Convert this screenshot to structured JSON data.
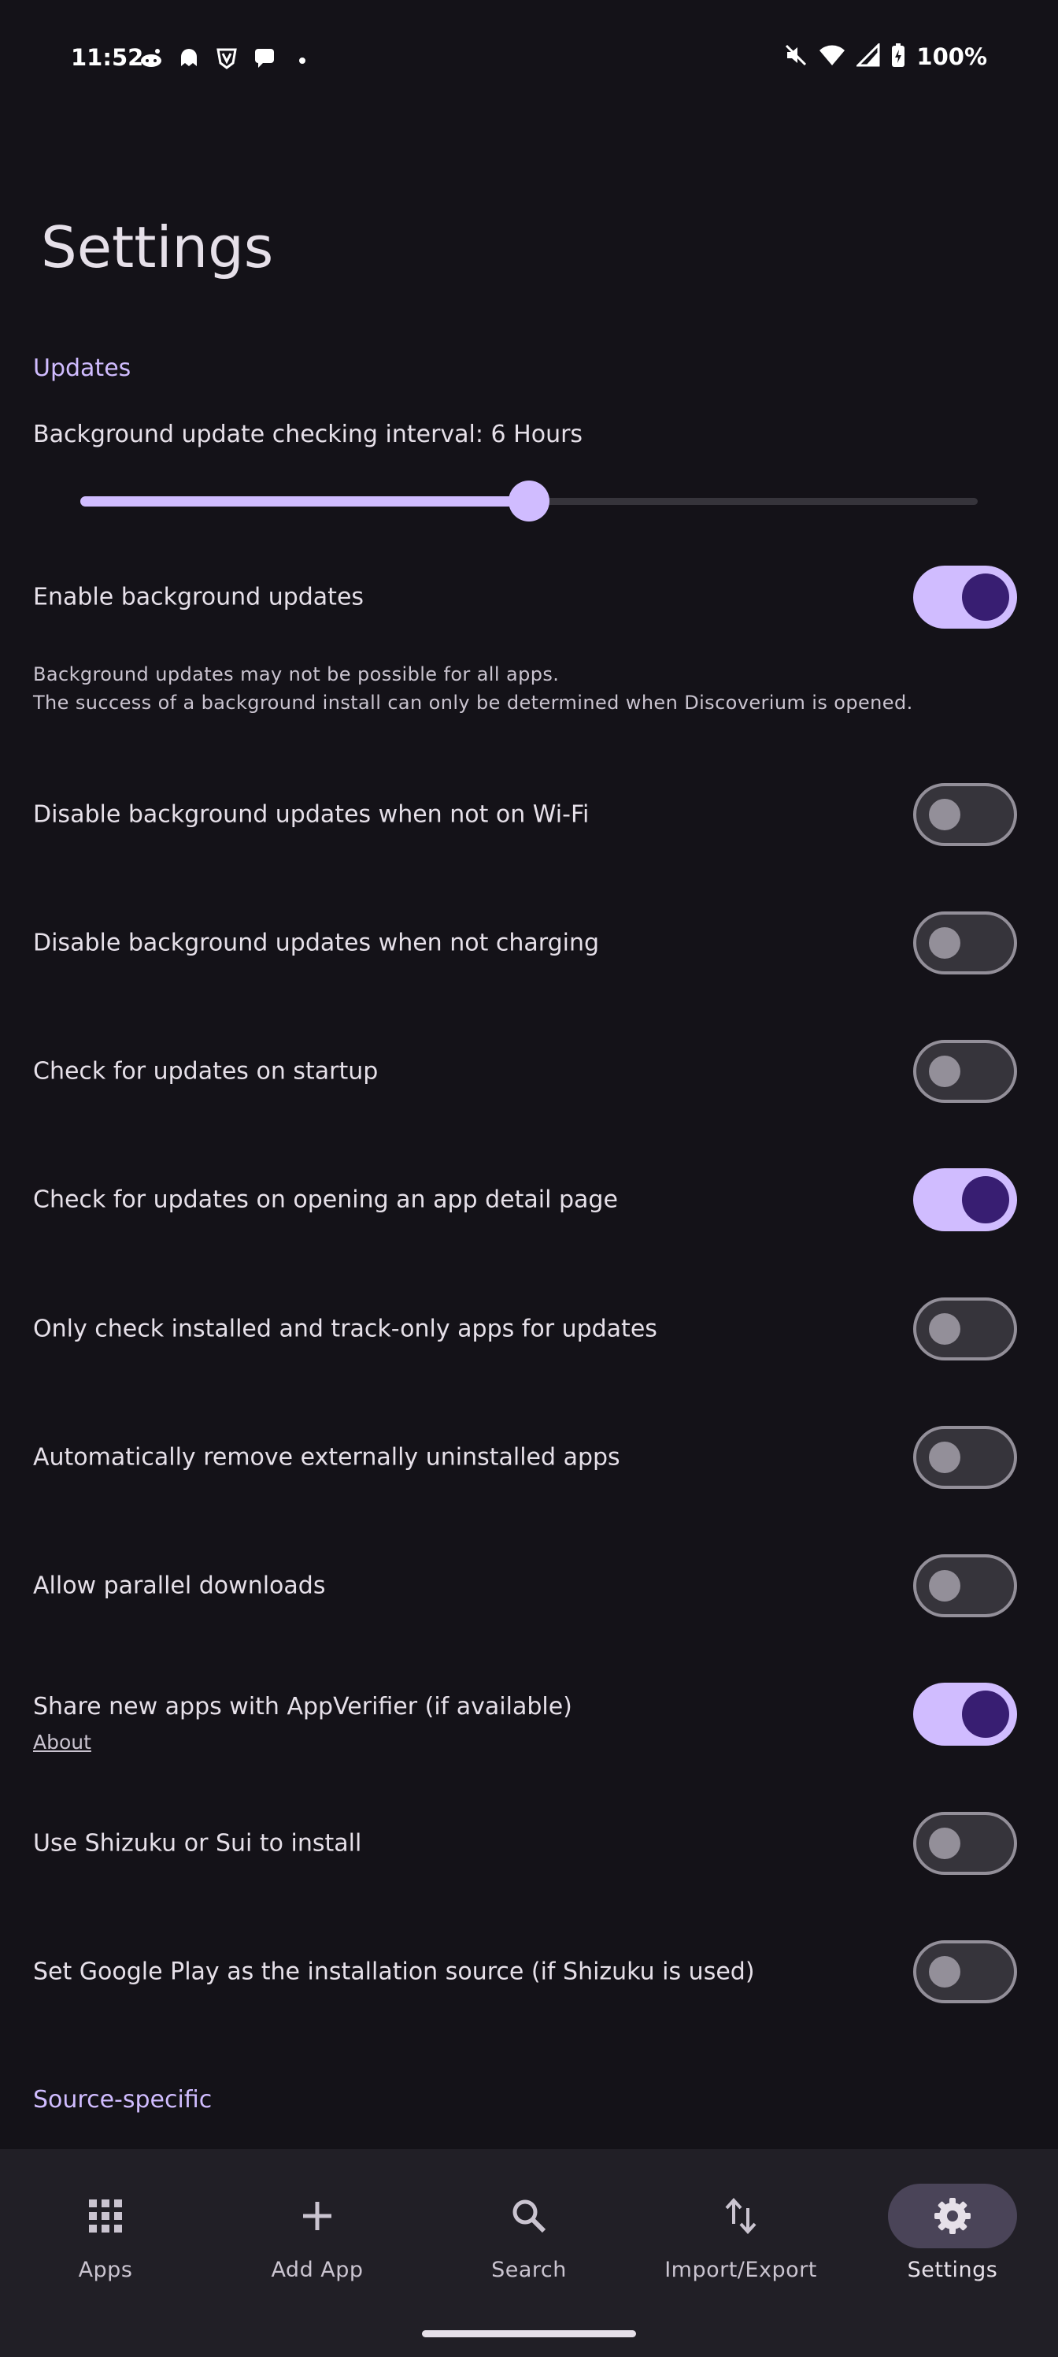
{
  "status_bar": {
    "time": "11:52",
    "notification_icons": [
      "reddit-icon",
      "ghost-icon",
      "shield-v-icon",
      "message-icon",
      "dot-icon"
    ],
    "right_icons": [
      "mute-icon",
      "wifi-icon",
      "signal-icon",
      "battery-charging-icon"
    ],
    "battery": "100%"
  },
  "page": {
    "title": "Settings"
  },
  "updates": {
    "header": "Updates",
    "interval_label": "Background update checking interval: 6 Hours",
    "interval_slider_fraction": 0.5,
    "rows": [
      {
        "label": "Enable background updates",
        "on": true
      },
      {
        "label": "Disable background updates when not on Wi-Fi",
        "on": false
      },
      {
        "label": "Disable background updates when not charging",
        "on": false
      },
      {
        "label": "Check for updates on startup",
        "on": false
      },
      {
        "label": "Check for updates on opening an app detail page",
        "on": true
      },
      {
        "label": "Only check installed and track-only apps for updates",
        "on": false
      },
      {
        "label": "Automatically remove externally uninstalled apps",
        "on": false
      },
      {
        "label": "Allow parallel downloads",
        "on": false
      },
      {
        "label": "Share new apps with AppVerifier (if available)",
        "on": true,
        "link": "About"
      },
      {
        "label": "Use Shizuku or Sui to install",
        "on": false
      },
      {
        "label": "Set Google Play as the installation source (if Shizuku is used)",
        "on": false
      }
    ],
    "helper_line1": "Background updates may not be possible for all apps.",
    "helper_line2": "The success of a background install can only be determined when Discoverium is opened."
  },
  "source_specific": {
    "header": "Source-specific"
  },
  "bottom_nav": {
    "items": [
      {
        "label": "Apps",
        "icon": "grid-icon",
        "active": false
      },
      {
        "label": "Add App",
        "icon": "plus-icon",
        "active": false
      },
      {
        "label": "Search",
        "icon": "search-icon",
        "active": false
      },
      {
        "label": "Import/Export",
        "icon": "import-export-icon",
        "active": false
      },
      {
        "label": "Settings",
        "icon": "gear-icon",
        "active": true
      }
    ]
  },
  "colors": {
    "background": "#141218",
    "accent": "#d0bcff",
    "switch_on_knob": "#381e72",
    "nav_background": "#211f26"
  }
}
